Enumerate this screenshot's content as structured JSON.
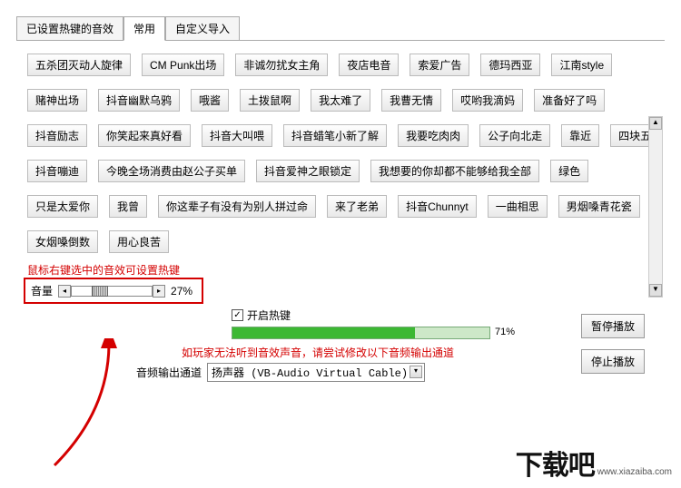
{
  "tabs": [
    "已设置热键的音效",
    "常用",
    "自定义导入"
  ],
  "tags": [
    "五杀团灭动人旋律",
    "CM Punk出场",
    "非诚勿扰女主角",
    "夜店电音",
    "索爱广告",
    "德玛西亚",
    "江南style",
    "赌神出场",
    "抖音幽默乌鸦",
    "哦酱",
    "土拨鼠啊",
    "我太难了",
    "我曹无情",
    "哎哟我滴妈",
    "准备好了吗",
    "抖音励志",
    "你笑起来真好看",
    "抖音大叫喂",
    "抖音蜡笔小新了解",
    "我要吃肉肉",
    "公子向北走",
    "靠近",
    "四块五",
    "抖音嘣迪",
    "今晚全场消费由赵公子买单",
    "抖音爱神之眼锁定",
    "我想要的你却都不能够给我全部",
    "绿色",
    "只是太爱你",
    "我曾",
    "你这辈子有没有为别人拼过命",
    "来了老弟",
    "抖音Chunnyt",
    "一曲相思",
    "男烟嗓青花瓷",
    "女烟嗓倒数",
    "用心良苦"
  ],
  "notes": {
    "hotkey_tip": "鼠标右键选中的音效可设置热键",
    "audio_tip": "如玩家无法听到音效声音，请尝试修改以下音频输出通道"
  },
  "volume": {
    "label": "音量",
    "value": "27%"
  },
  "hotkey": {
    "enable_label": "开启热键",
    "checked": true
  },
  "progress": {
    "percent_label": "71%",
    "percent": 71
  },
  "output": {
    "label": "音频输出通道",
    "value": "扬声器 (VB-Audio Virtual Cable)"
  },
  "buttons": {
    "pause": "暂停播放",
    "stop": "停止播放"
  },
  "watermark": {
    "main": "下载吧",
    "sub": "www.xiazaiba.com"
  }
}
